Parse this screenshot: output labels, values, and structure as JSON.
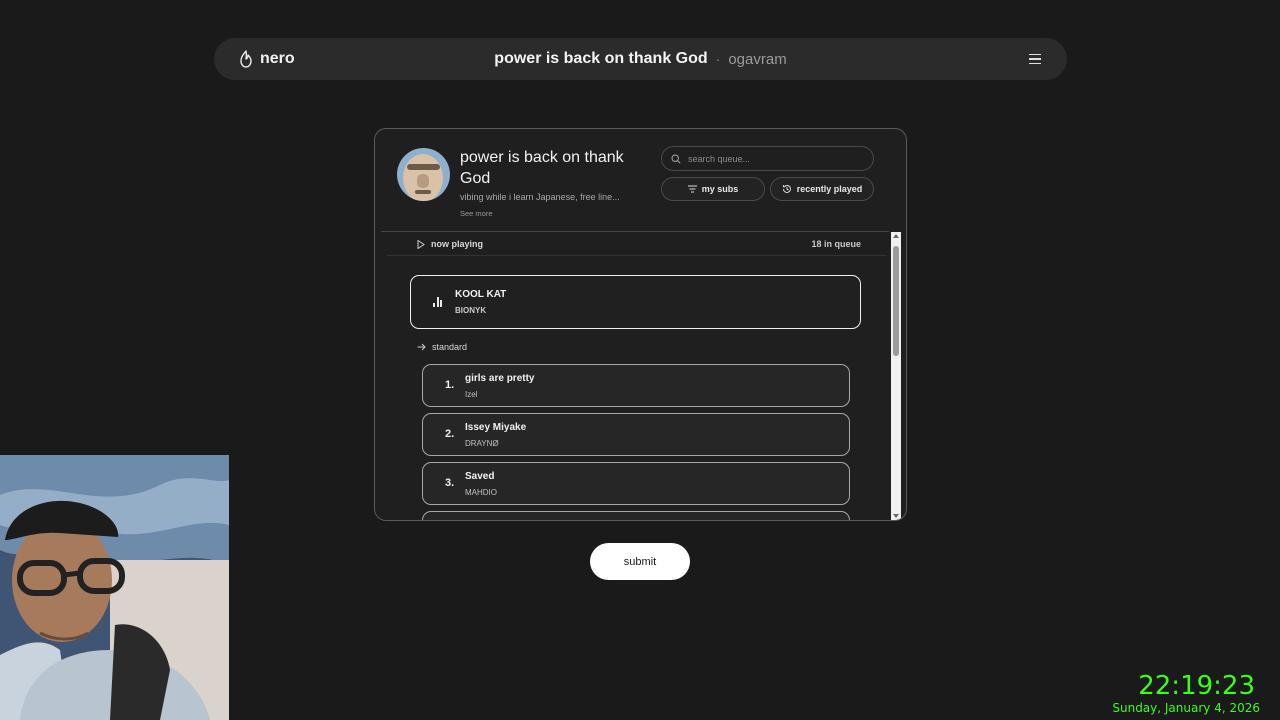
{
  "topbar": {
    "brand": "nero",
    "room_title": "power is back on thank God",
    "separator": "·",
    "username": "ogavram"
  },
  "room": {
    "title": "power is back on thank God",
    "description": "vibing while i learn Japanese, free line...",
    "see_more": "See more",
    "search_placeholder": "search queue...",
    "my_subs_label": "my subs",
    "recently_played_label": "recently played"
  },
  "queue": {
    "now_playing_label": "now playing",
    "count_label": "18 in queue",
    "now_playing": {
      "title": "KOOL KAT",
      "artist": "BIONYK"
    },
    "section_label": "standard",
    "items": [
      {
        "num": "1.",
        "title": "girls are pretty",
        "artist": "Izel"
      },
      {
        "num": "2.",
        "title": "Issey Miyake",
        "artist": "DRAYNØ"
      },
      {
        "num": "3.",
        "title": "Saved",
        "artist": "MAHDIO"
      }
    ]
  },
  "submit_label": "submit",
  "clock": {
    "time": "22:19:23",
    "date": "Sunday, January 4, 2026",
    "color": "#39ff14"
  }
}
